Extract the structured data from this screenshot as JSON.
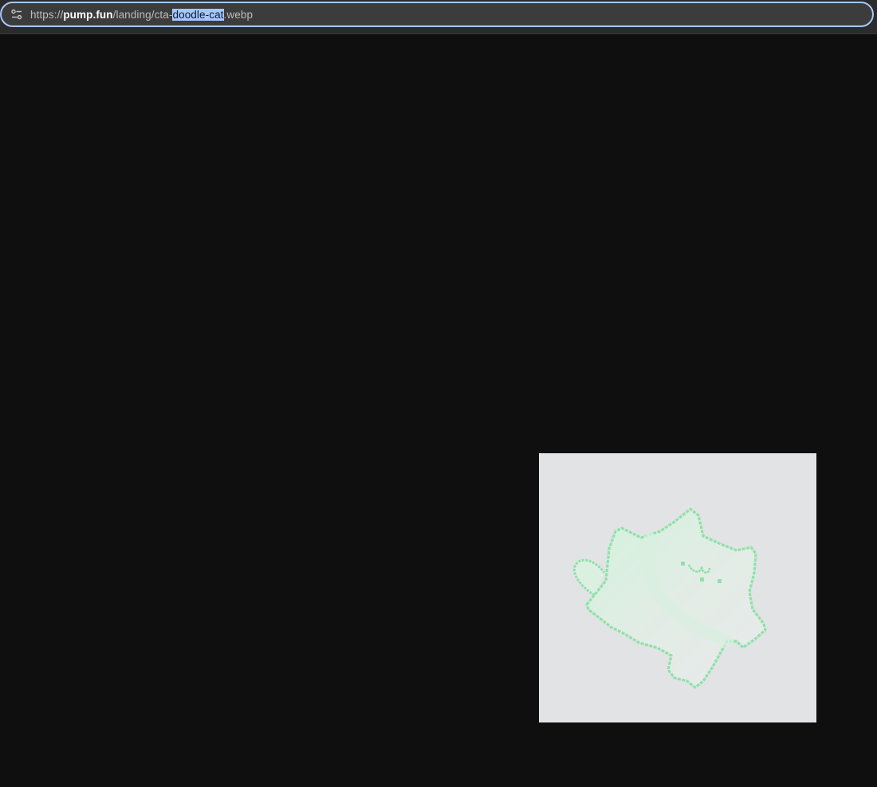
{
  "browser": {
    "url_scheme": "https://",
    "url_host": "pump.fun",
    "url_path_before": "/landing/cta-",
    "url_path_selected": "doodle-cat",
    "url_path_after": ".webp",
    "site_info_icon": "tune-icon",
    "accent_color": "#a8c7fa"
  },
  "page": {
    "background_color": "#0f0f0f",
    "image": {
      "subject": "doodle-cat",
      "background_color": "#e2e3e5",
      "outline_color": "#7fe0a0"
    }
  }
}
